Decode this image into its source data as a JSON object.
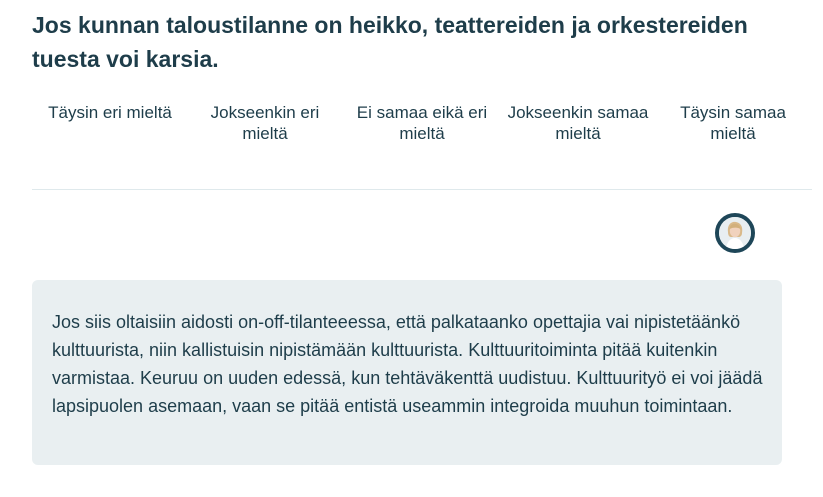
{
  "question": {
    "text": "Jos kunnan taloustilanne on heikko, teattereiden ja orkestereiden tuesta voi karsia."
  },
  "scale": {
    "options": [
      {
        "label": "Täysin eri mieltä"
      },
      {
        "label": "Jokseenkin eri mieltä"
      },
      {
        "label": "Ei samaa eikä eri mieltä"
      },
      {
        "label": "Jokseenkin samaa mieltä"
      },
      {
        "label": "Täysin samaa mieltä"
      }
    ]
  },
  "answer": {
    "avatar_icon": "candidate-avatar",
    "explanation": "Jos siis oltaisiin aidosti on-off-tilanteeessa, että palkataanko opettajia vai nipistetäänkö kulttuurista, niin kallistuisin nipistämään kulttuurista. Kulttuuritoiminta pitää kuitenkin varmistaa. Keuruu on uuden edessä, kun tehtäväkenttä uudistuu. Kulttuurityö ei voi jäädä lapsipuolen asemaan, vaan se pitää entistä useammin integroida muuhun toimintaan."
  },
  "colors": {
    "text": "#1e3d4a",
    "answer_background": "#e9eff1",
    "divider": "#dfe9ec",
    "avatar_border": "#1e4658"
  }
}
